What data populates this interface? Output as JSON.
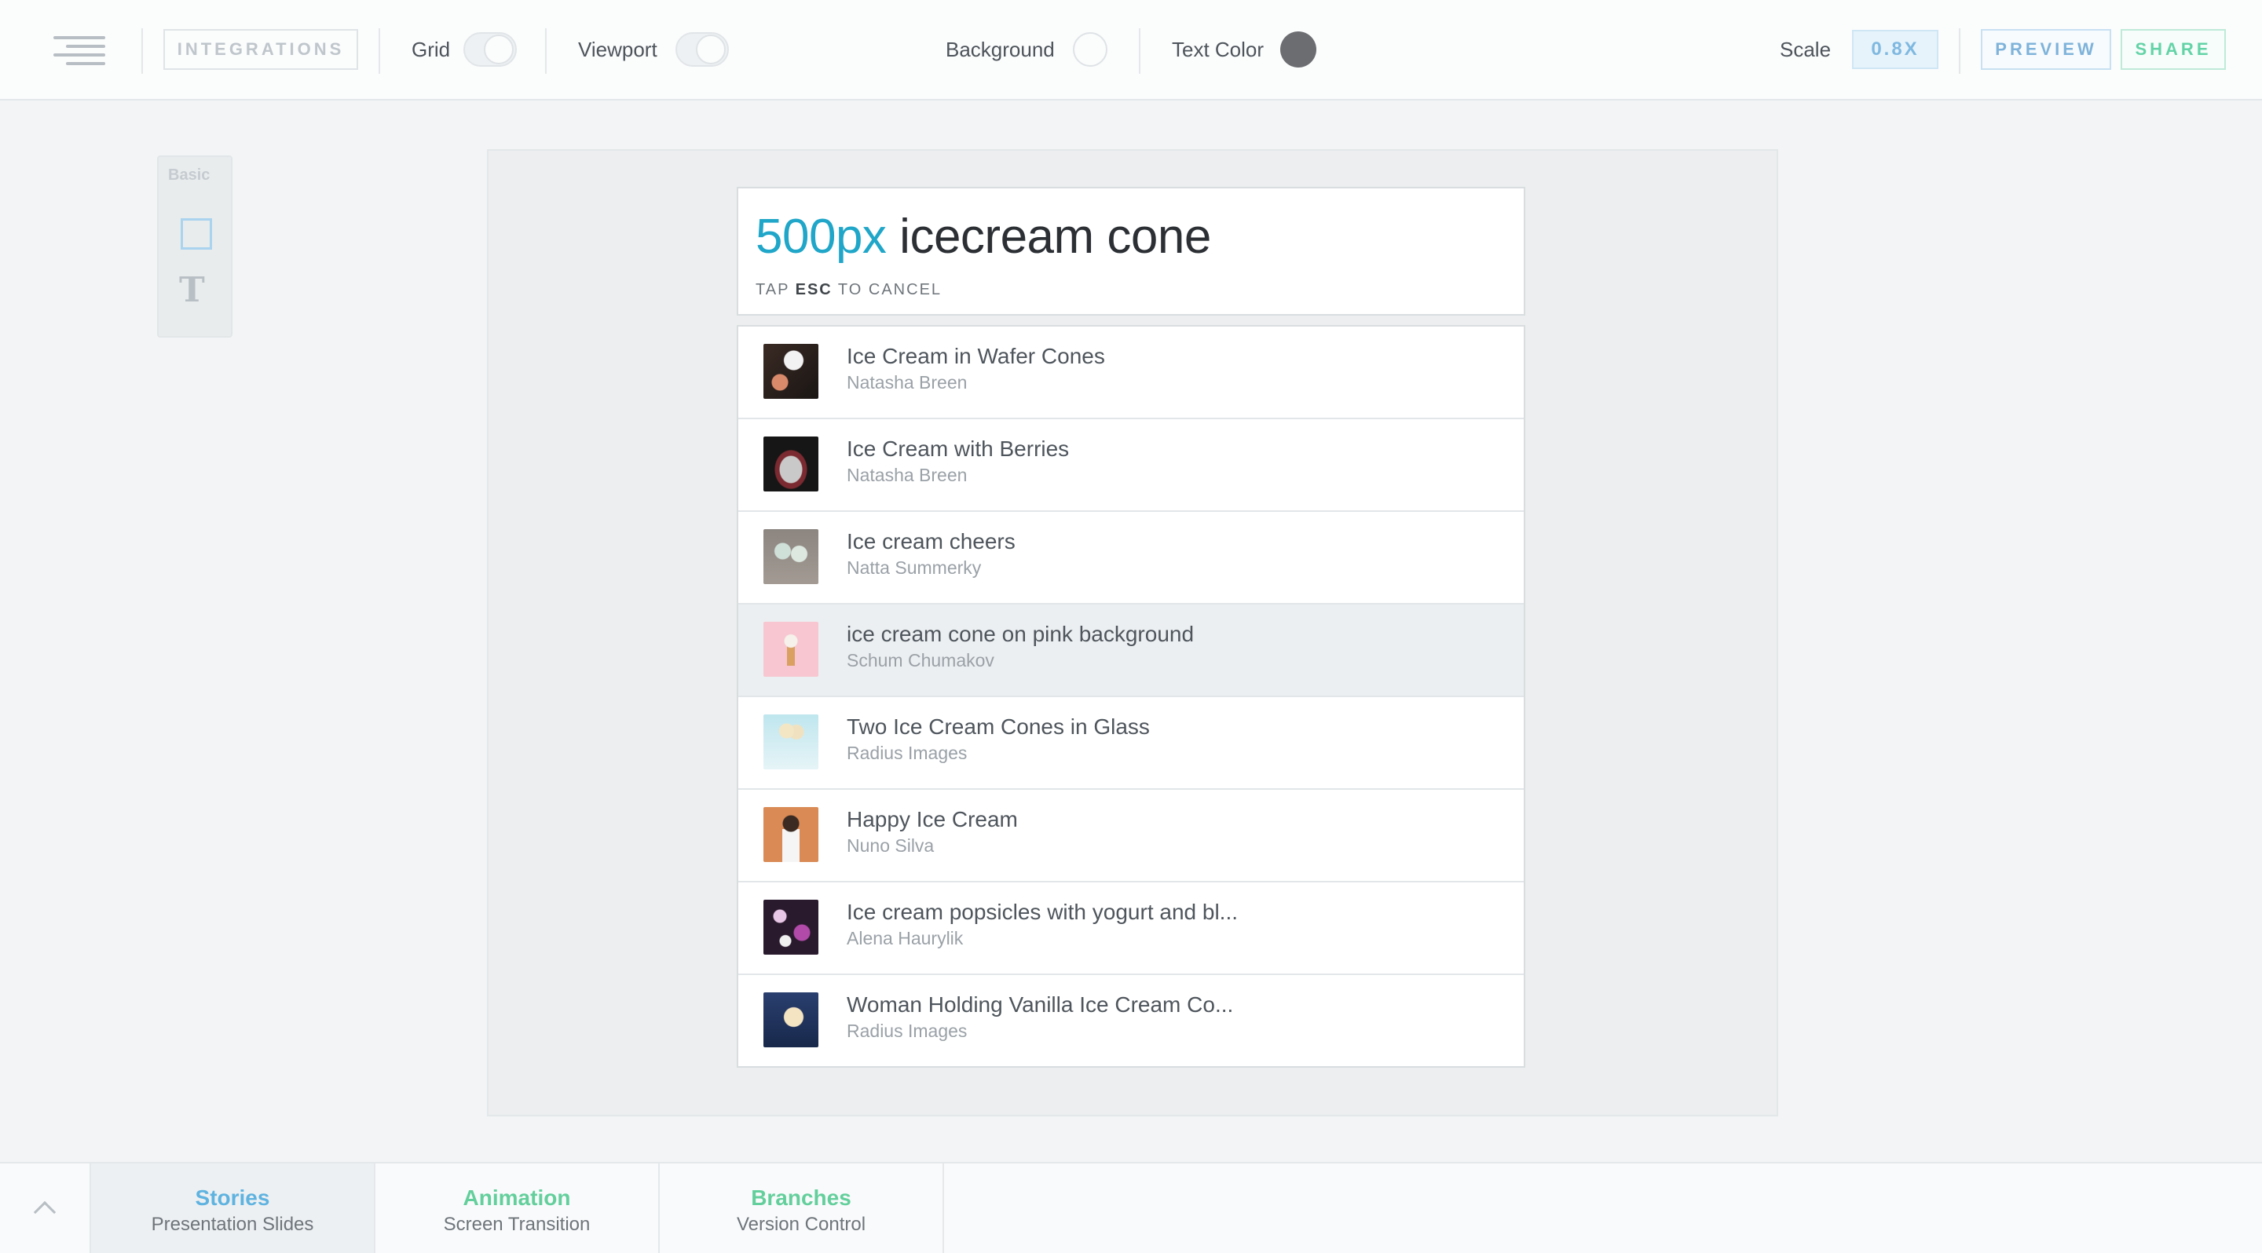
{
  "toolbar": {
    "integrations_label": "INTEGRATIONS",
    "grid_label": "Grid",
    "viewport_label": "Viewport",
    "background_label": "Background",
    "text_color_label": "Text Color",
    "text_color_value": "#6b6d70",
    "scale_label": "Scale",
    "scale_value": "0.8X",
    "preview_label": "PREVIEW",
    "share_label": "SHARE"
  },
  "palette": {
    "title": "Basic",
    "tools": [
      "rectangle",
      "text"
    ]
  },
  "search": {
    "prefix": "500px",
    "query": " icecream cone",
    "hint_pre": "TAP ",
    "hint_key": "ESC",
    "hint_post": " TO CANCEL"
  },
  "results": [
    {
      "title": "Ice Cream in Wafer Cones",
      "author": "Natasha Breen"
    },
    {
      "title": "Ice Cream with Berries",
      "author": "Natasha Breen"
    },
    {
      "title": "Ice cream cheers",
      "author": "Natta Summerky"
    },
    {
      "title": "ice cream cone on pink background",
      "author": "Schum Chumakov",
      "selected": true
    },
    {
      "title": "Two Ice Cream Cones in Glass",
      "author": "Radius Images"
    },
    {
      "title": "Happy Ice Cream",
      "author": "Nuno Silva"
    },
    {
      "title": "Ice cream popsicles with yogurt and bl...",
      "author": "Alena Haurylik"
    },
    {
      "title": "Woman Holding Vanilla Ice Cream Co...",
      "author": "Radius Images"
    }
  ],
  "bottom_tabs": [
    {
      "title": "Stories",
      "subtitle": "Presentation Slides",
      "color": "#5fb3e0",
      "active": true
    },
    {
      "title": "Animation",
      "subtitle": "Screen Transition",
      "color": "#63cf9c"
    },
    {
      "title": "Branches",
      "subtitle": "Version Control",
      "color": "#63cf9c"
    }
  ]
}
